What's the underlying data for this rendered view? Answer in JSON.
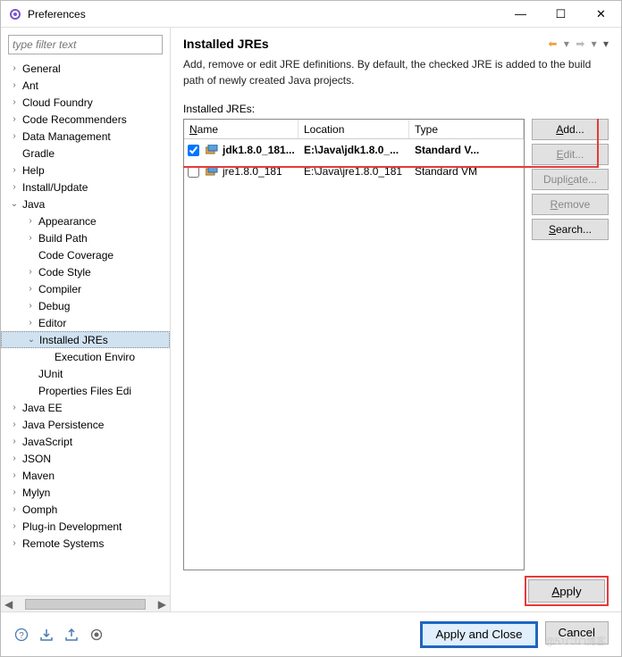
{
  "window": {
    "title": "Preferences"
  },
  "filter": {
    "placeholder": "type filter text"
  },
  "tree": [
    {
      "label": "General",
      "depth": 0,
      "expando": ">"
    },
    {
      "label": "Ant",
      "depth": 0,
      "expando": ">"
    },
    {
      "label": "Cloud Foundry",
      "depth": 0,
      "expando": ">"
    },
    {
      "label": "Code Recommenders",
      "depth": 0,
      "expando": ">"
    },
    {
      "label": "Data Management",
      "depth": 0,
      "expando": ">"
    },
    {
      "label": "Gradle",
      "depth": 0,
      "expando": ""
    },
    {
      "label": "Help",
      "depth": 0,
      "expando": ">"
    },
    {
      "label": "Install/Update",
      "depth": 0,
      "expando": ">"
    },
    {
      "label": "Java",
      "depth": 0,
      "expando": "v"
    },
    {
      "label": "Appearance",
      "depth": 1,
      "expando": ">"
    },
    {
      "label": "Build Path",
      "depth": 1,
      "expando": ">"
    },
    {
      "label": "Code Coverage",
      "depth": 1,
      "expando": ""
    },
    {
      "label": "Code Style",
      "depth": 1,
      "expando": ">"
    },
    {
      "label": "Compiler",
      "depth": 1,
      "expando": ">"
    },
    {
      "label": "Debug",
      "depth": 1,
      "expando": ">"
    },
    {
      "label": "Editor",
      "depth": 1,
      "expando": ">"
    },
    {
      "label": "Installed JREs",
      "depth": 1,
      "expando": "v",
      "selected": true
    },
    {
      "label": "Execution Enviro",
      "depth": 2,
      "expando": ""
    },
    {
      "label": "JUnit",
      "depth": 1,
      "expando": ""
    },
    {
      "label": "Properties Files Edi",
      "depth": 1,
      "expando": ""
    },
    {
      "label": "Java EE",
      "depth": 0,
      "expando": ">"
    },
    {
      "label": "Java Persistence",
      "depth": 0,
      "expando": ">"
    },
    {
      "label": "JavaScript",
      "depth": 0,
      "expando": ">"
    },
    {
      "label": "JSON",
      "depth": 0,
      "expando": ">"
    },
    {
      "label": "Maven",
      "depth": 0,
      "expando": ">"
    },
    {
      "label": "Mylyn",
      "depth": 0,
      "expando": ">"
    },
    {
      "label": "Oomph",
      "depth": 0,
      "expando": ">"
    },
    {
      "label": "Plug-in Development",
      "depth": 0,
      "expando": ">"
    },
    {
      "label": "Remote Systems",
      "depth": 0,
      "expando": ">"
    }
  ],
  "header": {
    "title": "Installed JREs"
  },
  "description": "Add, remove or edit JRE definitions. By default, the checked JRE is added to the build path of newly created Java projects.",
  "installed_label": "Installed JREs:",
  "columns": {
    "name": "Name",
    "location": "Location",
    "type": "Type"
  },
  "rows": [
    {
      "checked": true,
      "name": "jdk1.8.0_181...",
      "location": "E:\\Java\\jdk1.8.0_...",
      "type": "Standard V...",
      "bold": true
    },
    {
      "checked": false,
      "name": "jre1.8.0_181",
      "location": "E:\\Java\\jre1.8.0_181",
      "type": "Standard VM",
      "bold": false
    }
  ],
  "buttons": {
    "add": "Add...",
    "edit": "Edit...",
    "duplicate": "Duplicate...",
    "remove": "Remove",
    "search": "Search...",
    "apply": "Apply",
    "apply_close": "Apply and Close",
    "cancel": "Cancel"
  },
  "watermark": "@51CTO博客"
}
